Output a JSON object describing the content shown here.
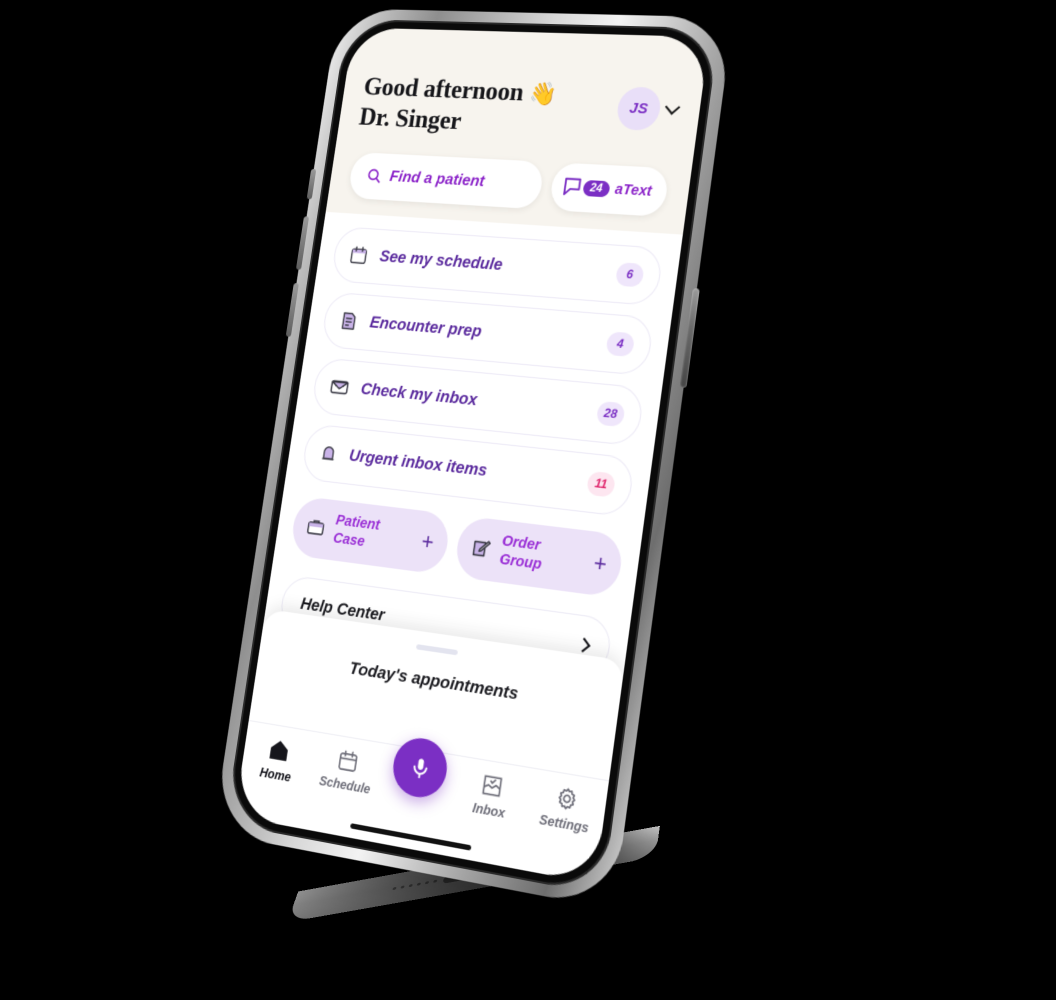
{
  "header": {
    "greeting_line1": "Good afternoon",
    "wave_emoji": "👋",
    "greeting_line2": "Dr. Singer",
    "avatar_initials": "JS",
    "search_placeholder": "Find a patient",
    "atext_count": "24",
    "atext_label": "aText"
  },
  "menu": {
    "items": [
      {
        "label": "See my schedule",
        "badge": "6",
        "icon": "calendar-icon"
      },
      {
        "label": "Encounter prep",
        "badge": "4",
        "icon": "document-icon"
      },
      {
        "label": "Check my inbox",
        "badge": "28",
        "icon": "envelope-icon"
      },
      {
        "label": "Urgent inbox items",
        "badge": "11",
        "icon": "bell-icon"
      }
    ]
  },
  "chips": [
    {
      "label_line1": "Patient",
      "label_line2": "Case",
      "action": "+",
      "icon": "briefcase-icon"
    },
    {
      "label_line1": "Order",
      "label_line2": "Group",
      "action": "+",
      "icon": "edit-note-icon"
    }
  ],
  "help": {
    "label": "Help Center"
  },
  "sheet": {
    "title": "Today's appointments"
  },
  "nav": {
    "items": [
      {
        "label": "Home",
        "icon": "home-icon",
        "active": true
      },
      {
        "label": "Schedule",
        "icon": "calendar-icon",
        "active": false
      },
      {
        "label": "Inbox",
        "icon": "inbox-icon",
        "active": false
      },
      {
        "label": "Settings",
        "icon": "gear-icon",
        "active": false
      }
    ],
    "fab_icon": "microphone-icon"
  },
  "colors": {
    "brand_purple": "#7b2fc4",
    "link_purple": "#8b23c9",
    "lavender": "#ece2f8",
    "cream": "#f7f4ee",
    "alert_pink": "#e0246b"
  }
}
